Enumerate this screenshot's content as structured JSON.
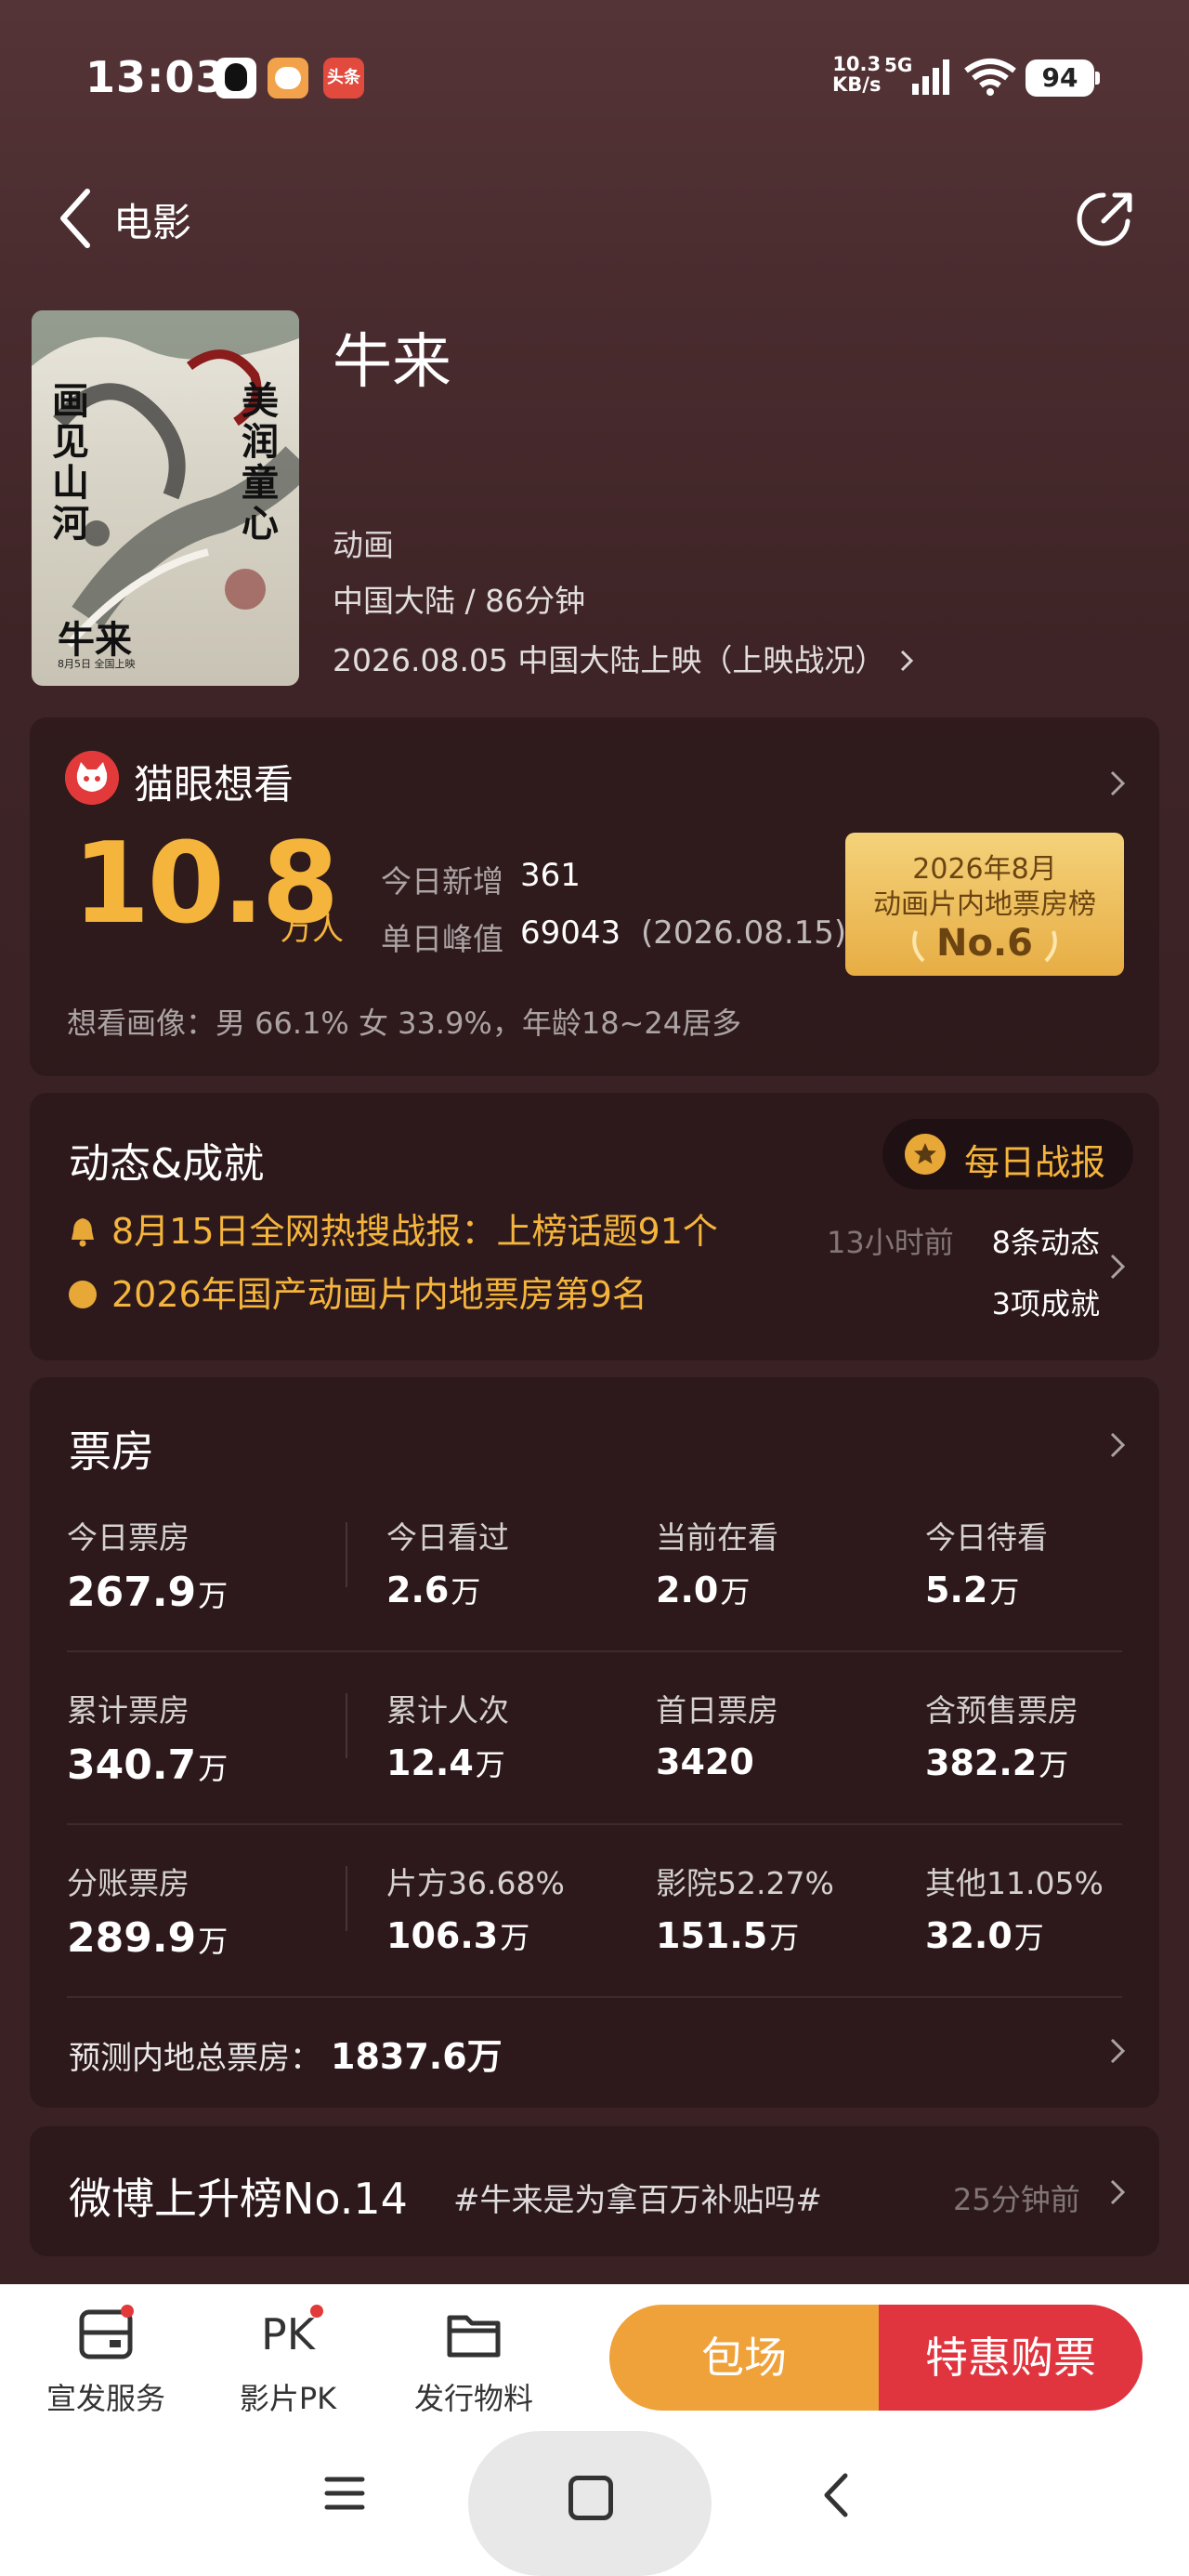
{
  "status_bar": {
    "time": "13:03",
    "speed_top": "10.3",
    "speed_bottom": "KB/s",
    "network": "5G",
    "battery": "94",
    "app_toutiao": "头条"
  },
  "nav": {
    "title": "电影"
  },
  "movie": {
    "title": "牛来",
    "genre": "动画",
    "meta": "中国大陆 / 86分钟",
    "release": "2026.08.05 中国大陆上映（上映战况）",
    "poster_text_1": "画见山河",
    "poster_text_2": "美润童心",
    "poster_title": "牛来",
    "poster_date": "8月5日 全国上映"
  },
  "want": {
    "title": "猫眼想看",
    "count": "10.8",
    "unit": "万人",
    "today_label": "今日新增",
    "today_value": "361",
    "peak_label": "单日峰值",
    "peak_value": "69043",
    "peak_date": "(2026.08.15)",
    "rank_line1": "2026年8月",
    "rank_line2": "动画片内地票房榜",
    "rank_no": "No.6",
    "profile": "想看画像：男 66.1%  女 33.9%，年龄18~24居多"
  },
  "achievements": {
    "title": "动态&成就",
    "daily_button": "每日战报",
    "row1": "8月15日全网热搜战报：上榜话题91个",
    "row1_time": "13小时前",
    "row2": "2026年国产动画片内地票房第9名",
    "count_dynamic": "8条动态",
    "count_achievement": "3项成就"
  },
  "box_office": {
    "title": "票房",
    "cells": [
      {
        "label": "今日票房",
        "value": "267.9",
        "unit": "万"
      },
      {
        "label": "今日看过",
        "value": "2.6",
        "unit": "万"
      },
      {
        "label": "当前在看",
        "value": "2.0",
        "unit": "万"
      },
      {
        "label": "今日待看",
        "value": "5.2",
        "unit": "万"
      },
      {
        "label": "累计票房",
        "value": "340.7",
        "unit": "万"
      },
      {
        "label": "累计人次",
        "value": "12.4",
        "unit": "万"
      },
      {
        "label": "首日票房",
        "value": "3420",
        "unit": ""
      },
      {
        "label": "含预售票房",
        "value": "382.2",
        "unit": "万"
      },
      {
        "label": "分账票房",
        "value": "289.9",
        "unit": "万"
      },
      {
        "label": "片方36.68%",
        "value": "106.3",
        "unit": "万"
      },
      {
        "label": "影院52.27%",
        "value": "151.5",
        "unit": "万"
      },
      {
        "label": "其他11.05%",
        "value": "32.0",
        "unit": "万"
      }
    ],
    "forecast_label": "预测内地总票房：",
    "forecast_value": "1837.6万"
  },
  "weibo": {
    "title": "微博上升榜No.14",
    "topic": "#牛来是为拿百万补贴吗#",
    "time": "25分钟前"
  },
  "bottom_bar": {
    "promo": "宣发服务",
    "pk": "影片PK",
    "pk_icon_text": "PK",
    "materials": "发行物料",
    "block_booking": "包场",
    "buy_ticket": "特惠购票"
  },
  "colors": {
    "accent_gold": "#f5b53c",
    "buy_red": "#e0343f",
    "block_orange": "#f0a23a",
    "bg_top": "#553437",
    "bg_bottom": "#3a2224"
  }
}
